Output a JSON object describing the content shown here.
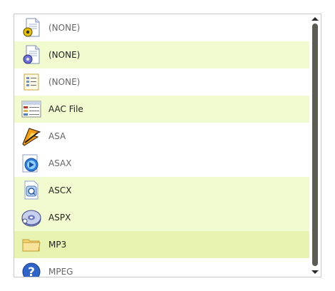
{
  "list": {
    "items": [
      {
        "label": "(NONE)",
        "icon": "document-gear-icon",
        "state": "normal"
      },
      {
        "label": "(NONE)",
        "icon": "document-gear-blue-icon",
        "state": "highlighted"
      },
      {
        "label": "(NONE)",
        "icon": "list-document-icon",
        "state": "normal"
      },
      {
        "label": "AAC File",
        "icon": "table-document-icon",
        "state": "highlighted"
      },
      {
        "label": "ASA",
        "icon": "winamp-lightning-icon",
        "state": "normal"
      },
      {
        "label": "ASAX",
        "icon": "media-player-icon",
        "state": "normal"
      },
      {
        "label": "ASCX",
        "icon": "quicktime-document-icon",
        "state": "highlighted"
      },
      {
        "label": "ASPX",
        "icon": "disc-icon",
        "state": "highlighted"
      },
      {
        "label": "MP3",
        "icon": "folder-icon",
        "state": "selected"
      },
      {
        "label": "MPEG",
        "icon": "help-question-icon",
        "state": "normal"
      }
    ]
  },
  "colors": {
    "highlight": "#f1fbcf",
    "selected": "#e8f3b2",
    "scroll_thumb": "#5c5c54"
  }
}
